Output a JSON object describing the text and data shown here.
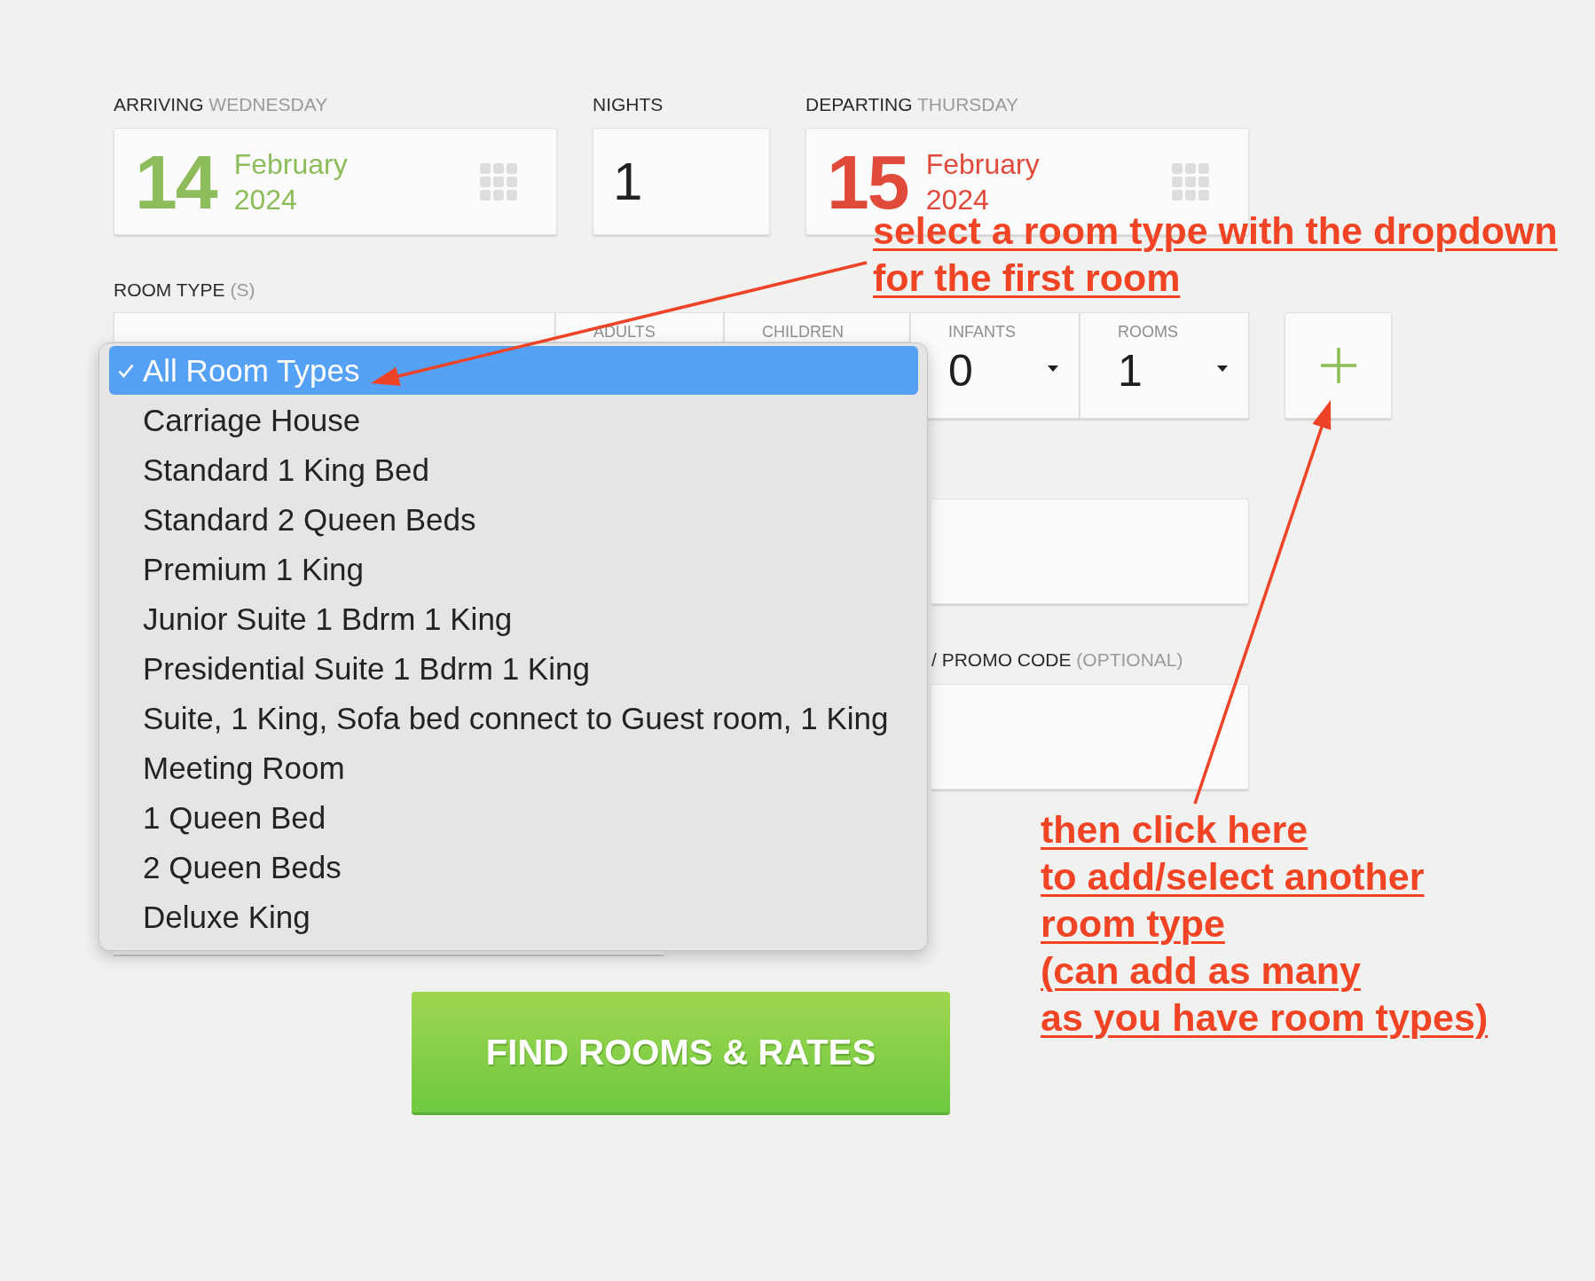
{
  "stay": {
    "arriving": {
      "label": "ARRIVING",
      "label_hint": "WEDNESDAY",
      "day": "14",
      "month": "February",
      "year": "2024"
    },
    "nights": {
      "label": "NIGHTS",
      "value": "1"
    },
    "departing": {
      "label": "DEPARTING",
      "label_hint": "THURSDAY",
      "day": "15",
      "month": "February",
      "year": "2024"
    }
  },
  "rooms": {
    "label": "ROOM TYPE",
    "label_hint": "(S)",
    "columns": [
      {
        "label": "ADULTS"
      },
      {
        "label": "CHILDREN"
      },
      {
        "label": "INFANTS",
        "value": "0"
      },
      {
        "label": "ROOMS",
        "value": "1"
      }
    ]
  },
  "room_type_menu": {
    "options": [
      {
        "label": "All Room Types",
        "selected": true
      },
      {
        "label": "Carriage House",
        "selected": false
      },
      {
        "label": "Standard 1 King Bed",
        "selected": false
      },
      {
        "label": "Standard 2 Queen Beds",
        "selected": false
      },
      {
        "label": "Premium 1 King",
        "selected": false
      },
      {
        "label": "Junior Suite 1 Bdrm 1 King",
        "selected": false
      },
      {
        "label": "Presidential Suite 1 Bdrm 1 King",
        "selected": false
      },
      {
        "label": "Suite, 1 King, Sofa bed connect to Guest room, 1 King",
        "selected": false
      },
      {
        "label": "Meeting Room",
        "selected": false
      },
      {
        "label": "1 Queen Bed",
        "selected": false
      },
      {
        "label": "2 Queen Beds",
        "selected": false
      },
      {
        "label": "Deluxe King",
        "selected": false
      }
    ]
  },
  "promo_code": {
    "label": "/ PROMO CODE",
    "label_hint": "(OPTIONAL)"
  },
  "search_button": {
    "label": "FIND ROOMS & RATES"
  },
  "annotations": [
    {
      "lines": [
        "select a room type with the dropdown",
        "for the first room"
      ]
    },
    {
      "lines": [
        "then click here",
        "to add/select another",
        "room type",
        "(can add as many",
        "as you have room types)"
      ]
    }
  ]
}
